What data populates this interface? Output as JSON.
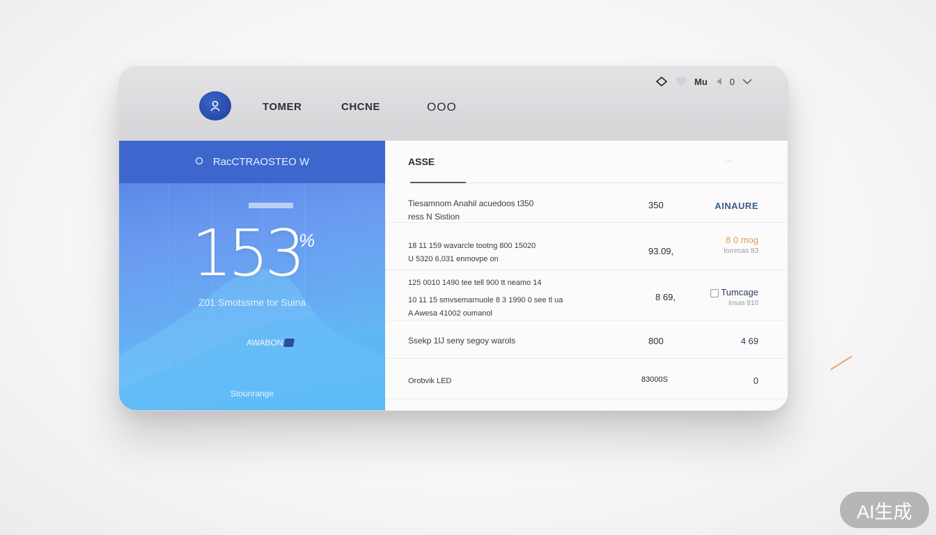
{
  "header": {
    "nav": [
      "TOMER",
      "CHCNE",
      "OOO"
    ],
    "controls": {
      "label": "Mu",
      "value": "0"
    }
  },
  "left_panel": {
    "title": "RacCTRAOSTEO W",
    "stat_value": "153",
    "stat_suffix": "%",
    "stat_caption": "Z01 Smotssme tor Suina",
    "badge": "AWABON",
    "footer": "Stounrange"
  },
  "right_panel": {
    "title": "ASSE",
    "rows": [
      {
        "desc": [
          "Tiesamnom Anahil acuedoos t350"
        ],
        "desc2": "ress N Sistion",
        "value": "350",
        "status": "AINAURE"
      },
      {
        "desc": [
          "18 11 159 wavarcle tootng 800 15020",
          "U 5320 6,031 enmovpe on"
        ],
        "value": "93.09,",
        "status": "8 0 mog",
        "status_sub": "lorrecas 83"
      },
      {
        "desc": [
          "125 0010 1490 tee tell 900 tt neamo 14",
          "10 11 15 smvsemarnuole 8 3 1990 0 see tl ua"
        ],
        "desc2": "A Awesa 41002 oumanol",
        "value": "8 69,",
        "status": "Tumcage",
        "status_sub": "lnsas 810"
      },
      {
        "desc": [
          "Ssekp 1lJ seny segoy warols"
        ],
        "value": "800",
        "status": "4 69"
      },
      {
        "desc": [
          "Orobvik LED"
        ],
        "value": "83000S",
        "status": "0"
      }
    ]
  },
  "colors": {
    "accent_blue": "#3d67cc",
    "panel_blue": "#63b6f4",
    "status_orange": "#e09a52"
  },
  "icons": {
    "avatar": "user-icon",
    "controls": [
      "diamond-icon",
      "heart-icon",
      "speaker-icon",
      "chevron-down-icon"
    ],
    "panel_title": "search-icon"
  },
  "watermark": "AI生成"
}
